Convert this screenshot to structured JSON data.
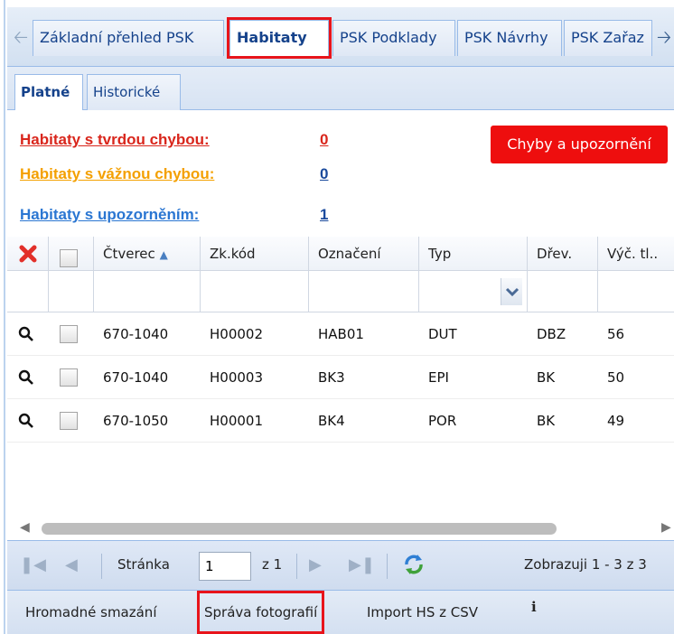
{
  "tabs": {
    "items": [
      {
        "label": "Základní přehled PSK"
      },
      {
        "label": "Habitaty"
      },
      {
        "label": "PSK Podklady"
      },
      {
        "label": "PSK Návrhy"
      },
      {
        "label": "PSK Zařaz"
      }
    ],
    "active": "Habitaty",
    "prev_icon": "arrow-left-icon",
    "next_icon": "arrow-right-icon"
  },
  "subtabs": {
    "items": [
      {
        "label": "Platné"
      },
      {
        "label": "Historické"
      }
    ],
    "active": "Platné"
  },
  "errors": {
    "hard": {
      "label": "Habitaty s tvrdou chybou:",
      "count": "0"
    },
    "serious": {
      "label": "Habitaty s vážnou chybou:",
      "count": "0"
    },
    "warning": {
      "label": "Habitaty s upozorněním:",
      "count": "1"
    },
    "button_label": "Chyby a upozornění",
    "colors": {
      "hard": "#d9261c",
      "serious": "#f4a000",
      "warning": "#2a76d2",
      "button": "#ee0e0e"
    }
  },
  "grid": {
    "columns": [
      "Čtverec",
      "Zk.kód",
      "Označení",
      "Typ",
      "Dřev.",
      "Výč. tl.."
    ],
    "sort_indicator": "▲",
    "rows": [
      [
        "670-1040",
        "H00002",
        "HAB01",
        "DUT",
        "DBZ",
        "56"
      ],
      [
        "670-1040",
        "H00003",
        "BK3",
        "EPI",
        "BK",
        "50"
      ],
      [
        "670-1050",
        "H00001",
        "BK4",
        "POR",
        "BK",
        "49"
      ]
    ]
  },
  "pager": {
    "page_label": "Stránka",
    "page_value": "1",
    "of_label": "z 1",
    "summary": "Zobrazuji 1 - 3 z 3"
  },
  "toolbar": {
    "bulk_delete": "Hromadné smazání",
    "photos": "Správa fotografií",
    "import": "Import HS z CSV",
    "info": "i"
  }
}
